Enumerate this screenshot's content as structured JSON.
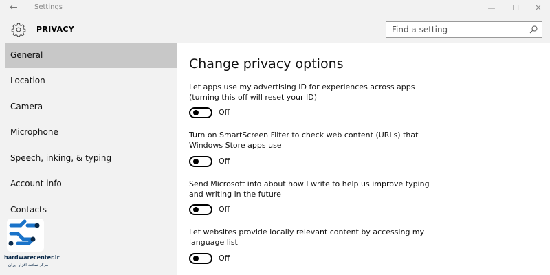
{
  "window": {
    "title": "Settings",
    "back_glyph": "←",
    "minimize_glyph": "—",
    "maximize_glyph": "☐",
    "close_glyph": "✕"
  },
  "header": {
    "title": "PRIVACY",
    "search_placeholder": "Find a setting"
  },
  "sidebar": {
    "items": [
      {
        "label": "General",
        "selected": true
      },
      {
        "label": "Location",
        "selected": false
      },
      {
        "label": "Camera",
        "selected": false
      },
      {
        "label": "Microphone",
        "selected": false
      },
      {
        "label": "Speech, inking, & typing",
        "selected": false
      },
      {
        "label": "Account info",
        "selected": false
      },
      {
        "label": "Contacts",
        "selected": false
      }
    ]
  },
  "main": {
    "title": "Change privacy options",
    "options": [
      {
        "description": "Let apps use my advertising ID for experiences across apps (turning this off will reset your ID)",
        "state": "Off"
      },
      {
        "description": "Turn on SmartScreen Filter to check web content (URLs) that Windows Store apps use",
        "state": "Off"
      },
      {
        "description": "Send Microsoft info about how I write to help us improve typing and writing in the future",
        "state": "Off"
      },
      {
        "description": "Let websites provide locally relevant content by accessing my language list",
        "state": "Off"
      }
    ]
  },
  "watermark": {
    "name": "hardwarecenter.ir",
    "subtitle": "مرکز سخت افزار ایران"
  },
  "colors": {
    "chrome_bg": "#f2f2f2",
    "selected_bg": "#c8c8c8",
    "logo_blue": "#1a73c9"
  }
}
